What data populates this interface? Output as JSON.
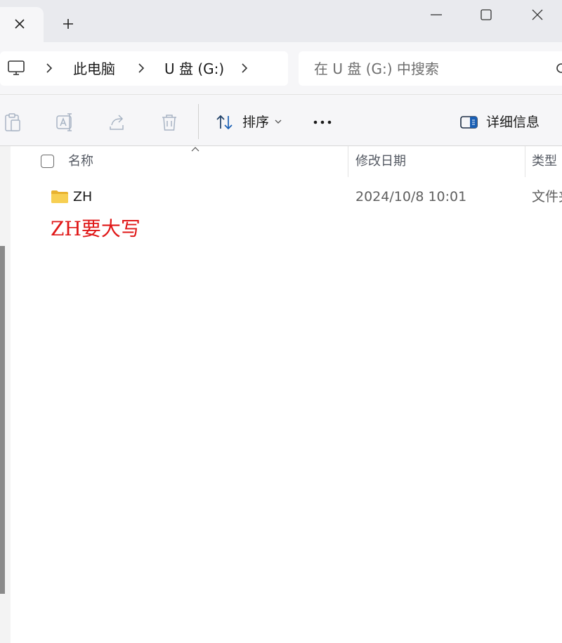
{
  "titlebar": {
    "icons": [
      "close-icon",
      "plus-icon",
      "minimize-icon",
      "maximize-icon",
      "window-close-icon"
    ]
  },
  "address": {
    "crumbs": [
      "此电脑",
      "U 盘 (G:)"
    ],
    "search_placeholder": "在 U 盘 (G:) 中搜索"
  },
  "toolbar": {
    "sort_label": "排序",
    "details_label": "详细信息",
    "icons": [
      "paste-icon",
      "rename-icon",
      "share-icon",
      "delete-icon",
      "sort-icon",
      "more-icon",
      "details-pane-icon"
    ]
  },
  "columns": {
    "name": "名称",
    "modified": "修改日期",
    "type": "类型"
  },
  "files": [
    {
      "name": "ZH",
      "modified": "2024/10/8 10:01",
      "type": "文件夹",
      "icon": "folder-icon"
    }
  ],
  "annotation": "ZH要大写",
  "colors": {
    "annotation": "#e01818",
    "folder": "#f5c842",
    "accent": "#1a5fb4"
  }
}
